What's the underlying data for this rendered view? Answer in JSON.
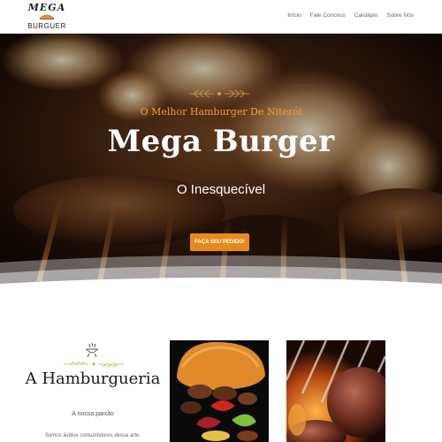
{
  "header": {
    "logo_top": "MEGA",
    "logo_bottom": "BURGUER",
    "nav": [
      "Início",
      "Fale Conosco",
      "Cardápio",
      "Sobre Nós"
    ]
  },
  "hero": {
    "subtitle": "O Melhor Hamburger De Niterói",
    "title": "Mega Burger",
    "tagline": "O Inesquecível",
    "cta_label": "FAÇA SEU PEDIDO!"
  },
  "about": {
    "title": "A Hamburgueria",
    "subtitle": "A nossa paixão",
    "body": "Somos ávidos consumidores dessa arte."
  },
  "icons": {
    "ornament": "wheat-ornament-icon",
    "grill": "grill-icon"
  },
  "colors": {
    "accent": "#e88a1a",
    "hero_subtitle": "#f0a23a",
    "hero_bg": "#1a0d06"
  }
}
